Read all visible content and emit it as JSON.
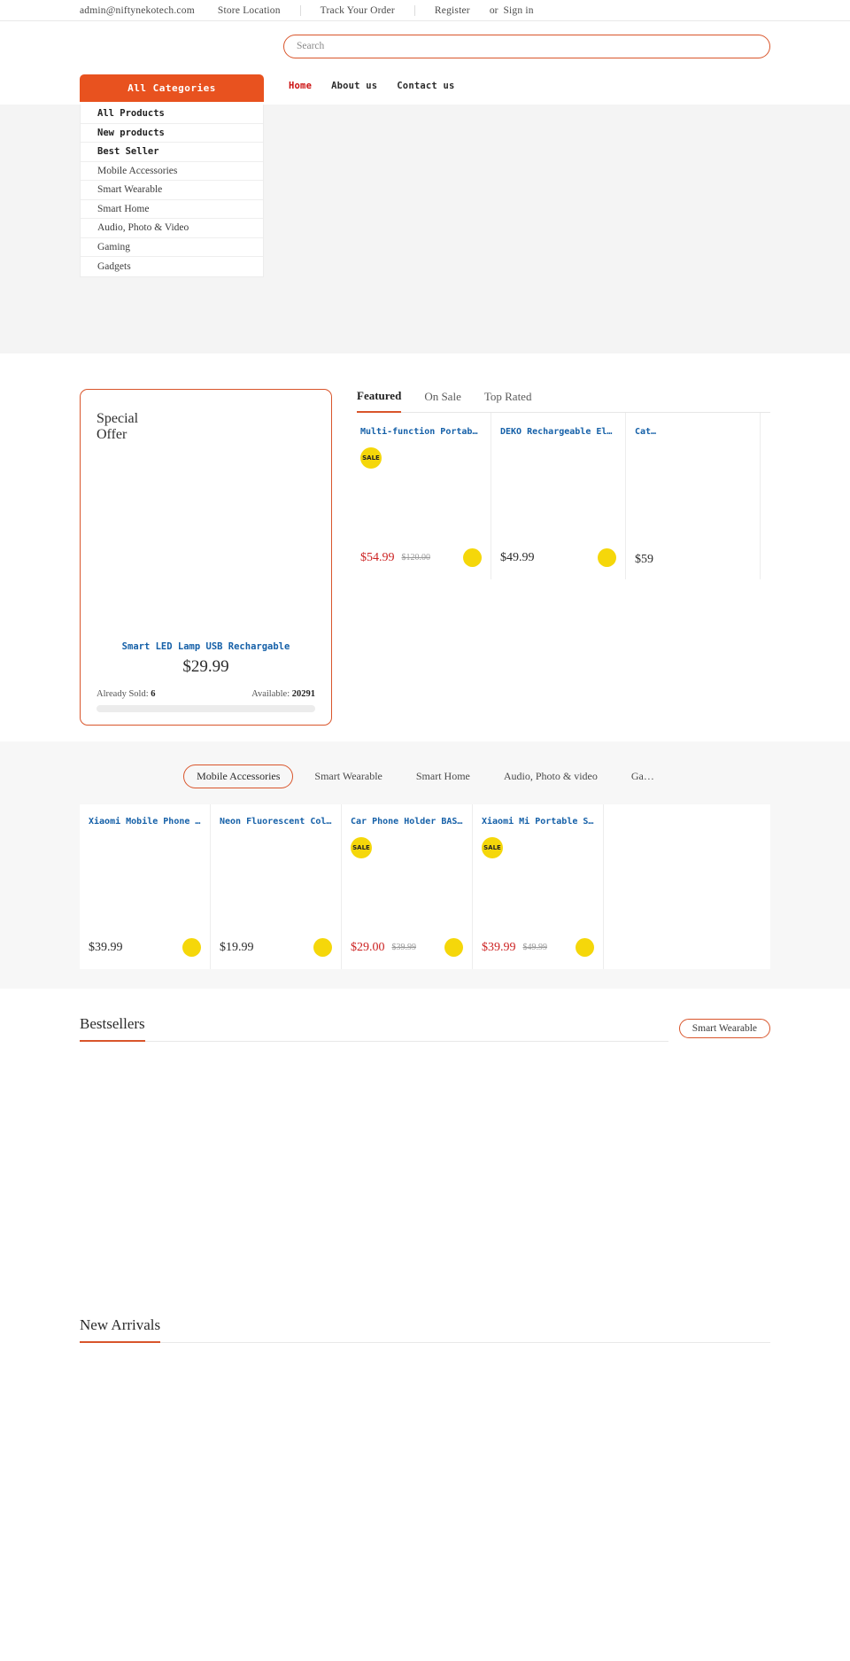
{
  "topbar": {
    "email": "admin@niftynekotech.com",
    "store_location": "Store Location",
    "track_order": "Track Your Order",
    "register": "Register",
    "or": "or",
    "signin": "Sign in"
  },
  "search": {
    "placeholder": "Search",
    "value": ""
  },
  "nav": {
    "all_categories": "All Categories",
    "links": [
      {
        "label": "Home",
        "active": true
      },
      {
        "label": "About us",
        "active": false
      },
      {
        "label": "Contact us",
        "active": false
      }
    ]
  },
  "categories": [
    {
      "label": "All Products",
      "mono": true
    },
    {
      "label": "New products",
      "mono": true
    },
    {
      "label": "Best Seller",
      "mono": true
    },
    {
      "label": "Mobile Accessories",
      "mono": false
    },
    {
      "label": "Smart Wearable",
      "mono": false
    },
    {
      "label": "Smart Home",
      "mono": false
    },
    {
      "label": "Audio, Photo & Video",
      "mono": false
    },
    {
      "label": "Gaming",
      "mono": false
    },
    {
      "label": "Gadgets",
      "mono": false
    }
  ],
  "special_offer": {
    "title_line1": "Special",
    "title_line2": "Offer",
    "product_name": "Smart LED Lamp USB Rechargable",
    "price": "$29.99",
    "sold_label": "Already Sold:",
    "sold_value": "6",
    "available_label": "Available:",
    "available_value": "20291",
    "progress_percent": 0
  },
  "featured": {
    "tabs": [
      {
        "label": "Featured",
        "active": true
      },
      {
        "label": "On Sale",
        "active": false
      },
      {
        "label": "Top Rated",
        "active": false
      }
    ],
    "products": [
      {
        "name": "Multi-function Portable…",
        "price": "$54.99",
        "old_price": "$120.00",
        "sale": true,
        "badge": "SALE"
      },
      {
        "name": "DEKO Rechargeable Elect…",
        "price": "$49.99",
        "old_price": "",
        "sale": false,
        "badge": ""
      },
      {
        "name": "Cat…",
        "price": "$59",
        "old_price": "",
        "sale": false,
        "badge": ""
      }
    ]
  },
  "category_section": {
    "pills": [
      {
        "label": "Mobile Accessories",
        "active": true
      },
      {
        "label": "Smart Wearable",
        "active": false
      },
      {
        "label": "Smart Home",
        "active": false
      },
      {
        "label": "Audio, Photo & video",
        "active": false
      },
      {
        "label": "Ga…",
        "active": false
      }
    ],
    "products": [
      {
        "name": "Xiaomi Mobile Phone Coo…",
        "price": "$39.99",
        "old_price": "",
        "sale": false,
        "badge": ""
      },
      {
        "name": "Neon Fluorescent Color …",
        "price": "$19.99",
        "old_price": "",
        "sale": false,
        "badge": ""
      },
      {
        "name": "Car Phone Holder BASEUS",
        "price": "$29.00",
        "old_price": "$39.99",
        "sale": true,
        "badge": "SALE"
      },
      {
        "name": "Xiaomi Mi Portable Self…",
        "price": "$39.99",
        "old_price": "$49.99",
        "sale": true,
        "badge": "SALE"
      }
    ]
  },
  "bestsellers": {
    "title": "Bestsellers",
    "pills": [
      {
        "label": "Smart Wearable"
      }
    ]
  },
  "new_arrivals": {
    "title": "New Arrivals"
  },
  "colors": {
    "accent": "#d9552b",
    "brand": "#e8521f",
    "link": "#1560a8",
    "sale": "#cc2222",
    "badge": "#f5d70a"
  }
}
